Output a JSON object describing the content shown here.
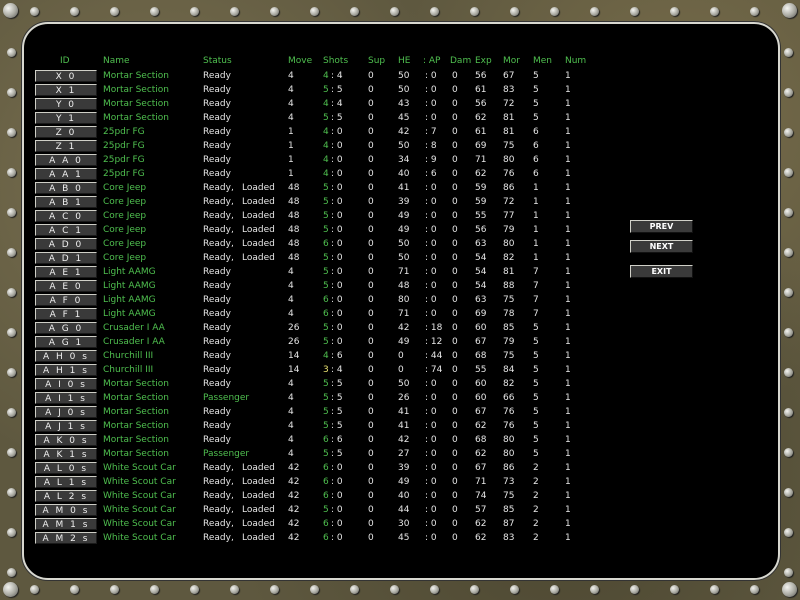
{
  "headers": {
    "id": "ID",
    "name": "Name",
    "status": "Status",
    "move": "Move",
    "shots": "Shots",
    "sup": "Sup",
    "he": "HE",
    "ap": ": AP",
    "dam": "Dam",
    "exp": "Exp",
    "mor": "Mor",
    "men": "Men",
    "num": "Num"
  },
  "buttons": {
    "prev": "PREV",
    "next": "NEXT",
    "exit": "EXIT"
  },
  "colors": {
    "label_green": "#4fbf4f",
    "low_ammo": "#e8e070",
    "panel": "#000000"
  },
  "rows": [
    [
      "X 0",
      "Mortar Section",
      "Ready",
      "",
      "4",
      "4",
      ": 4",
      "0",
      "50",
      ": 0",
      "0",
      "56",
      "67",
      "5",
      "1"
    ],
    [
      "X 1",
      "Mortar Section",
      "Ready",
      "",
      "4",
      "5",
      ": 5",
      "0",
      "50",
      ": 0",
      "0",
      "61",
      "83",
      "5",
      "1"
    ],
    [
      "Y 0",
      "Mortar Section",
      "Ready",
      "",
      "4",
      "4",
      ": 4",
      "0",
      "43",
      ": 0",
      "0",
      "56",
      "72",
      "5",
      "1"
    ],
    [
      "Y 1",
      "Mortar Section",
      "Ready",
      "",
      "4",
      "5",
      ": 5",
      "0",
      "45",
      ": 0",
      "0",
      "62",
      "81",
      "5",
      "1"
    ],
    [
      "Z 0",
      "25pdr FG",
      "Ready",
      "",
      "1",
      "4",
      ": 0",
      "0",
      "42",
      ": 7",
      "0",
      "61",
      "81",
      "6",
      "1"
    ],
    [
      "Z 1",
      "25pdr FG",
      "Ready",
      "",
      "1",
      "4",
      ": 0",
      "0",
      "50",
      ": 8",
      "0",
      "69",
      "75",
      "6",
      "1"
    ],
    [
      "A A 0",
      "25pdr FG",
      "Ready",
      "",
      "1",
      "4",
      ": 0",
      "0",
      "34",
      ": 9",
      "0",
      "71",
      "80",
      "6",
      "1"
    ],
    [
      "A A 1",
      "25pdr FG",
      "Ready",
      "",
      "1",
      "4",
      ": 0",
      "0",
      "40",
      ": 6",
      "0",
      "62",
      "76",
      "6",
      "1"
    ],
    [
      "A B 0",
      "Core Jeep",
      "Ready,",
      "Loaded",
      "48",
      "5",
      ": 0",
      "0",
      "41",
      ": 0",
      "0",
      "59",
      "86",
      "1",
      "1"
    ],
    [
      "A B 1",
      "Core Jeep",
      "Ready,",
      "Loaded",
      "48",
      "5",
      ": 0",
      "0",
      "39",
      ": 0",
      "0",
      "59",
      "72",
      "1",
      "1"
    ],
    [
      "A C 0",
      "Core Jeep",
      "Ready,",
      "Loaded",
      "48",
      "5",
      ": 0",
      "0",
      "49",
      ": 0",
      "0",
      "55",
      "77",
      "1",
      "1"
    ],
    [
      "A C 1",
      "Core Jeep",
      "Ready,",
      "Loaded",
      "48",
      "5",
      ": 0",
      "0",
      "49",
      ": 0",
      "0",
      "56",
      "79",
      "1",
      "1"
    ],
    [
      "A D 0",
      "Core Jeep",
      "Ready,",
      "Loaded",
      "48",
      "6",
      ": 0",
      "0",
      "50",
      ": 0",
      "0",
      "63",
      "80",
      "1",
      "1"
    ],
    [
      "A D 1",
      "Core Jeep",
      "Ready,",
      "Loaded",
      "48",
      "5",
      ": 0",
      "0",
      "50",
      ": 0",
      "0",
      "54",
      "82",
      "1",
      "1"
    ],
    [
      "A E 1",
      "Light AAMG",
      "Ready",
      "",
      "4",
      "5",
      ": 0",
      "0",
      "71",
      ": 0",
      "0",
      "54",
      "81",
      "7",
      "1"
    ],
    [
      "A E 0",
      "Light AAMG",
      "Ready",
      "",
      "4",
      "5",
      ": 0",
      "0",
      "48",
      ": 0",
      "0",
      "54",
      "88",
      "7",
      "1"
    ],
    [
      "A F 0",
      "Light AAMG",
      "Ready",
      "",
      "4",
      "6",
      ": 0",
      "0",
      "80",
      ": 0",
      "0",
      "63",
      "75",
      "7",
      "1"
    ],
    [
      "A F 1",
      "Light AAMG",
      "Ready",
      "",
      "4",
      "6",
      ": 0",
      "0",
      "71",
      ": 0",
      "0",
      "69",
      "78",
      "7",
      "1"
    ],
    [
      "A G 0",
      "Crusader I AA",
      "Ready",
      "",
      "26",
      "5",
      ": 0",
      "0",
      "42",
      ": 18",
      "0",
      "60",
      "85",
      "5",
      "1"
    ],
    [
      "A G 1",
      "Crusader I AA",
      "Ready",
      "",
      "26",
      "5",
      ": 0",
      "0",
      "49",
      ": 12",
      "0",
      "67",
      "79",
      "5",
      "1"
    ],
    [
      "A H 0 s",
      "Churchill III",
      "Ready",
      "",
      "14",
      "4",
      ": 6",
      "0",
      "0",
      ": 44",
      "0",
      "68",
      "75",
      "5",
      "1"
    ],
    [
      "A H 1 s",
      "Churchill III",
      "Ready",
      "",
      "14",
      "3",
      ": 4",
      "0",
      "0",
      ": 74",
      "0",
      "55",
      "84",
      "5",
      "1"
    ],
    [
      "A I 0 s",
      "Mortar Section",
      "Ready",
      "",
      "4",
      "5",
      ": 5",
      "0",
      "50",
      ": 0",
      "0",
      "60",
      "82",
      "5",
      "1"
    ],
    [
      "A I 1 s",
      "Mortar Section",
      "Passenger",
      "",
      "4",
      "5",
      ": 5",
      "0",
      "26",
      ": 0",
      "0",
      "60",
      "66",
      "5",
      "1"
    ],
    [
      "A J 0 s",
      "Mortar Section",
      "Ready",
      "",
      "4",
      "5",
      ": 5",
      "0",
      "41",
      ": 0",
      "0",
      "67",
      "76",
      "5",
      "1"
    ],
    [
      "A J 1 s",
      "Mortar Section",
      "Ready",
      "",
      "4",
      "5",
      ": 5",
      "0",
      "41",
      ": 0",
      "0",
      "62",
      "76",
      "5",
      "1"
    ],
    [
      "A K 0 s",
      "Mortar Section",
      "Ready",
      "",
      "4",
      "6",
      ": 6",
      "0",
      "42",
      ": 0",
      "0",
      "68",
      "80",
      "5",
      "1"
    ],
    [
      "A K 1 s",
      "Mortar Section",
      "Passenger",
      "",
      "4",
      "5",
      ": 5",
      "0",
      "27",
      ": 0",
      "0",
      "62",
      "80",
      "5",
      "1"
    ],
    [
      "A L 0 s",
      "White Scout Car",
      "Ready,",
      "Loaded",
      "42",
      "6",
      ": 0",
      "0",
      "39",
      ": 0",
      "0",
      "67",
      "86",
      "2",
      "1"
    ],
    [
      "A L 1 s",
      "White Scout Car",
      "Ready,",
      "Loaded",
      "42",
      "6",
      ": 0",
      "0",
      "49",
      ": 0",
      "0",
      "71",
      "73",
      "2",
      "1"
    ],
    [
      "A L 2 s",
      "White Scout Car",
      "Ready,",
      "Loaded",
      "42",
      "6",
      ": 0",
      "0",
      "40",
      ": 0",
      "0",
      "74",
      "75",
      "2",
      "1"
    ],
    [
      "A M 0 s",
      "White Scout Car",
      "Ready,",
      "Loaded",
      "42",
      "5",
      ": 0",
      "0",
      "44",
      ": 0",
      "0",
      "57",
      "85",
      "2",
      "1"
    ],
    [
      "A M 1 s",
      "White Scout Car",
      "Ready,",
      "Loaded",
      "42",
      "6",
      ": 0",
      "0",
      "30",
      ": 0",
      "0",
      "62",
      "87",
      "2",
      "1"
    ],
    [
      "A M 2 s",
      "White Scout Car",
      "Ready,",
      "Loaded",
      "42",
      "6",
      ": 0",
      "0",
      "45",
      ": 0",
      "0",
      "62",
      "83",
      "2",
      "1"
    ]
  ]
}
